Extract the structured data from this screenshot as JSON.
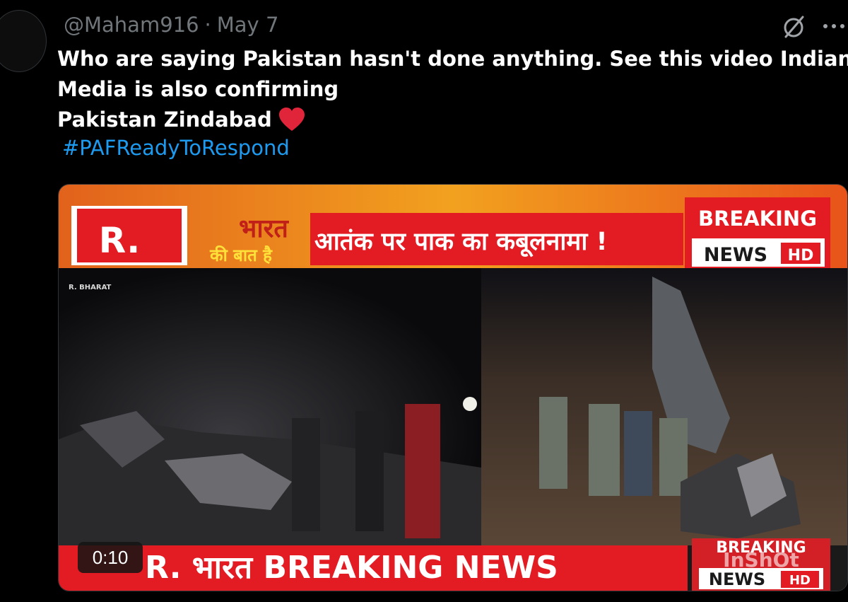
{
  "tweet": {
    "handle": "@Maham916",
    "separator": "·",
    "date": "May 7",
    "text_lines": [
      "Who are saying Pakistan hasn't done anything. See this video Indian",
      "Media is also confirming",
      "Pakistan Zindabad"
    ],
    "hashtag": "#PAFReadyToRespond"
  },
  "icons": {
    "grok": "grok-icon",
    "more": "more-icon",
    "heart": "heart-icon"
  },
  "video": {
    "channel_logo": "R.",
    "show_logo_line1": "भारत",
    "show_logo_line2": "की बात है",
    "top_headline": "आतंक पर पाक का कबूलनामा !",
    "badge_top": "BREAKING",
    "badge_news": "NEWS",
    "badge_hd": "HD",
    "corner_tag": "R. BHARAT",
    "bottom_ticker": "R. भारत BREAKING NEWS",
    "watermark": "InShOt",
    "duration": "0:10"
  },
  "colors": {
    "background": "#000000",
    "text": "#ffffff",
    "muted": "#71767b",
    "link": "#1d9bf0",
    "heart": "#f4212e",
    "banner_red": "#e31b23"
  }
}
